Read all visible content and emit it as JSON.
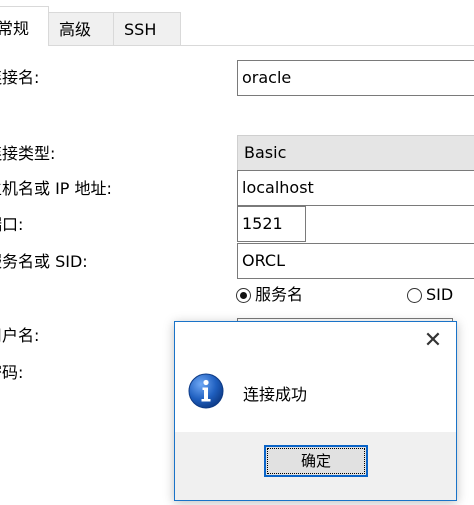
{
  "tabs": [
    {
      "label": "常规",
      "active": true
    },
    {
      "label": "高级",
      "active": false
    },
    {
      "label": "SSH",
      "active": false
    }
  ],
  "form": {
    "connection_name_label": "连接名:",
    "connection_name_value": "oracle",
    "connection_type_label": "连接类型:",
    "connection_type_value": "Basic",
    "host_label": "主机名或 IP 地址:",
    "host_value": "localhost",
    "port_label": "端口:",
    "port_value": "1521",
    "service_label": "服务名或 SID:",
    "service_value": "ORCL",
    "radio_service_name": "服务名",
    "radio_sid": "SID",
    "username_label": "用户名:",
    "password_label": "密码:"
  },
  "dialog": {
    "message": "连接成功",
    "ok_label": "确定",
    "close_glyph": "✕"
  },
  "colors": {
    "accent": "#0a64c8",
    "dialog_border": "#1a73c8",
    "info_icon": "#1f5fbf"
  }
}
